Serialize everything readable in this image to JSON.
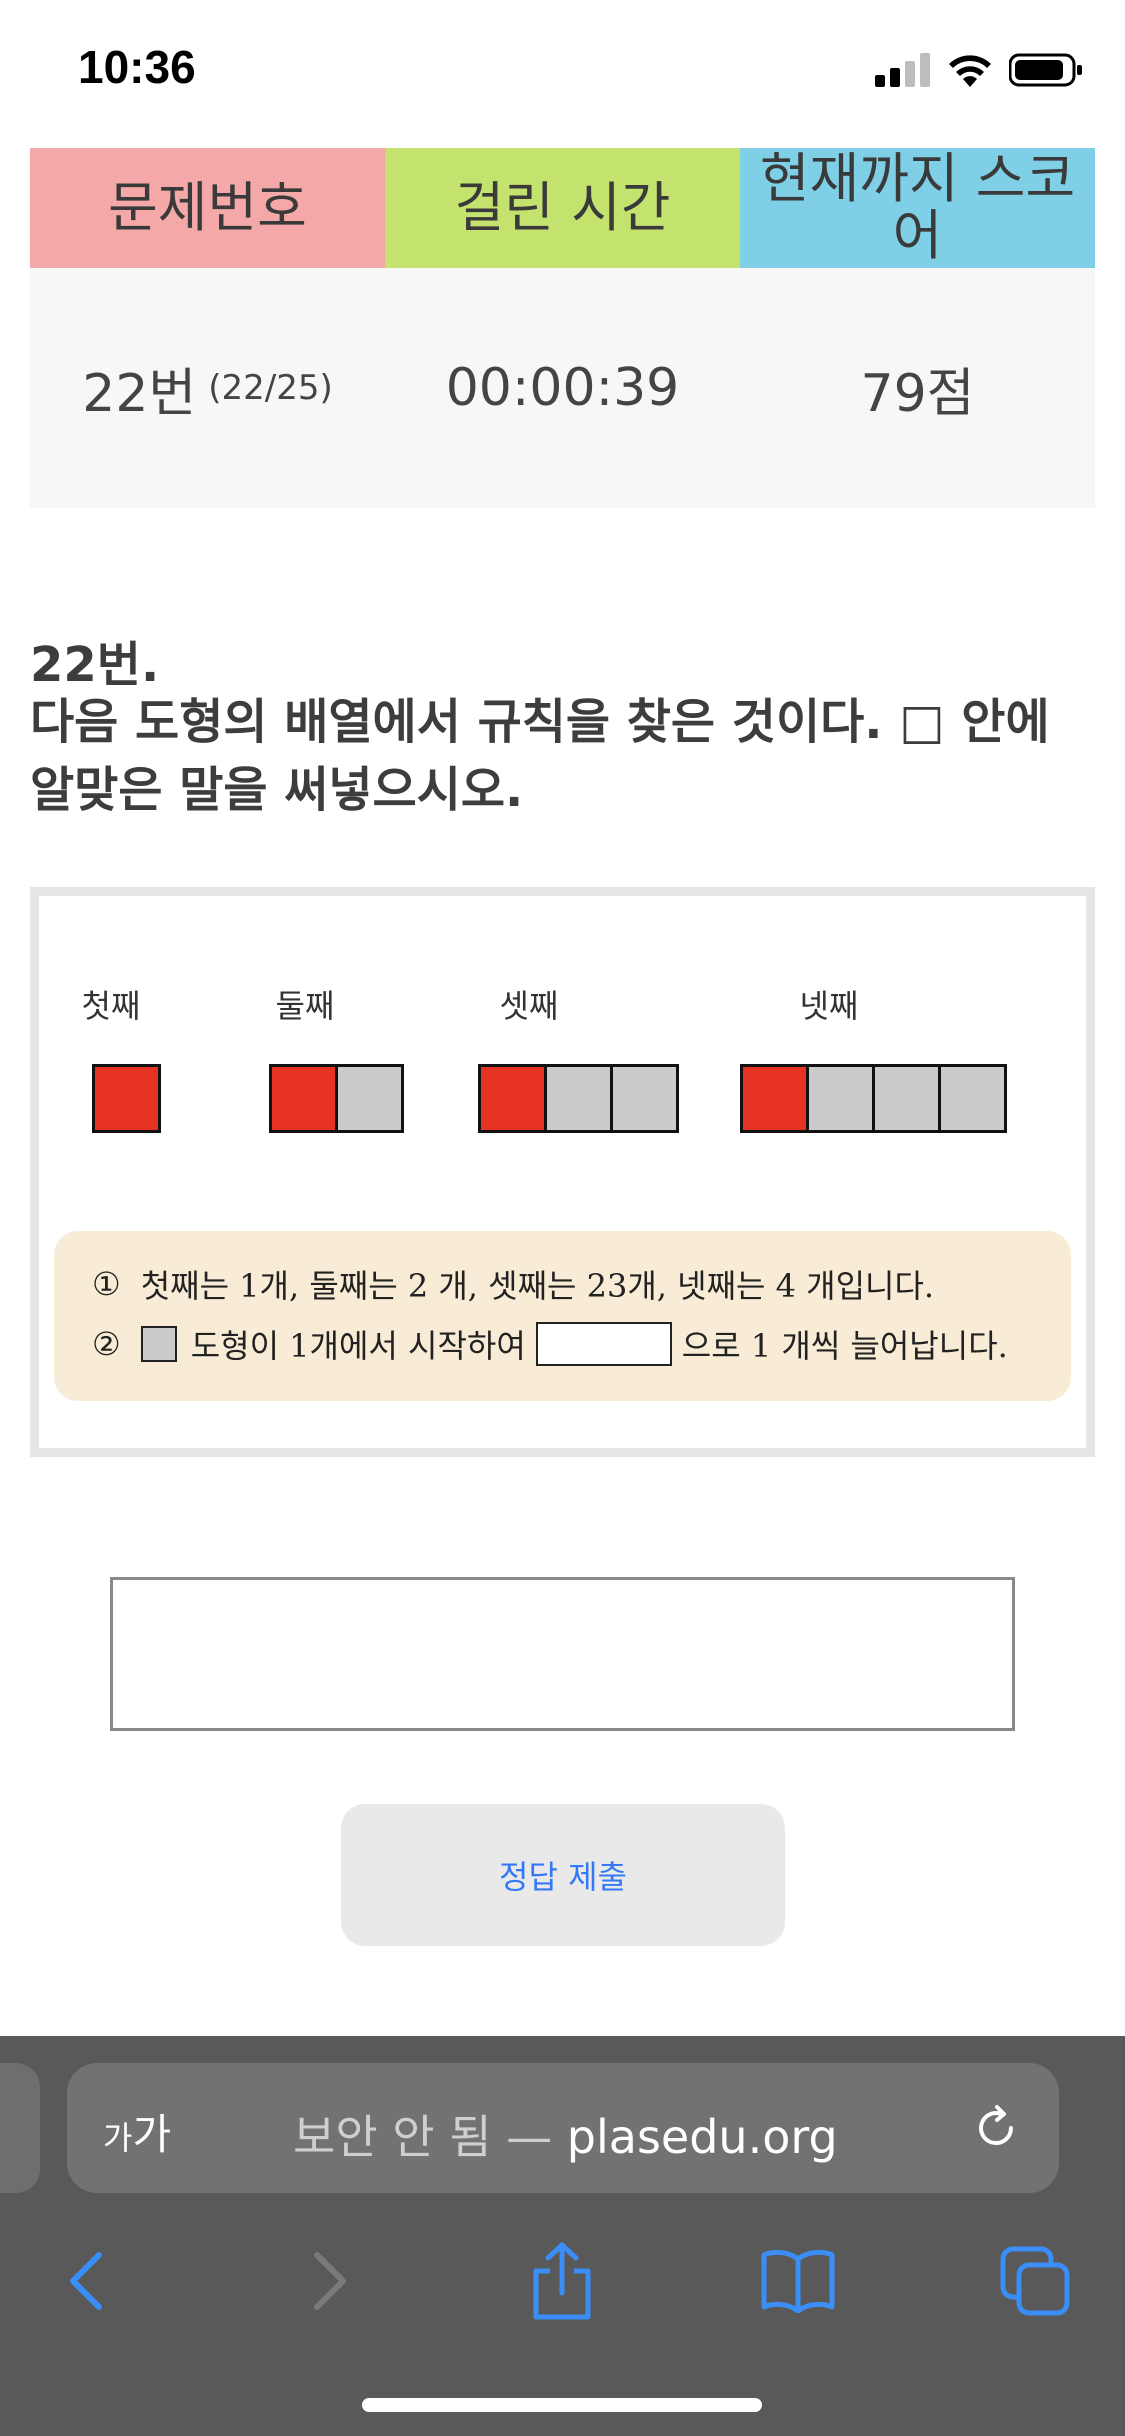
{
  "status": {
    "time": "10:36"
  },
  "score_table": {
    "headers": [
      "문제번호",
      "걸린 시간",
      "현재까지 스코어"
    ],
    "question_no": "22번",
    "question_progress": "(22/25)",
    "elapsed": "00:00:39",
    "score": "79점"
  },
  "question": {
    "number": "22번.",
    "text": "다음 도형의 배열에서 규칙을 찾은 것이다. □ 안에 알맞은 말을 써넣으시오."
  },
  "figure": {
    "labels": [
      "첫째",
      "둘째",
      "셋째",
      "넷째"
    ],
    "hint_1_num": "①",
    "hint_1": "첫째는 1개, 둘째는 2 개, 셋째는 23개, 넷째는 4 개입니다.",
    "hint_2_num": "②",
    "hint_2_before": "도형이 1개에서 시작하여",
    "hint_2_after": "으로 1 개씩 늘어납니다."
  },
  "colors": {
    "red_square": "#e63222",
    "gray_square": "#cbcbcb",
    "link_blue": "#3478f6"
  },
  "answer": {
    "value": ""
  },
  "submit": {
    "label": "정답 제출"
  },
  "browser": {
    "font_size_small": "가",
    "font_size_large": "가",
    "security": "보안 안 됨 —",
    "domain": "plasedu.org",
    "icons": [
      "back-icon",
      "forward-icon",
      "share-icon",
      "bookmarks-icon",
      "tabs-icon",
      "reload-icon"
    ]
  }
}
